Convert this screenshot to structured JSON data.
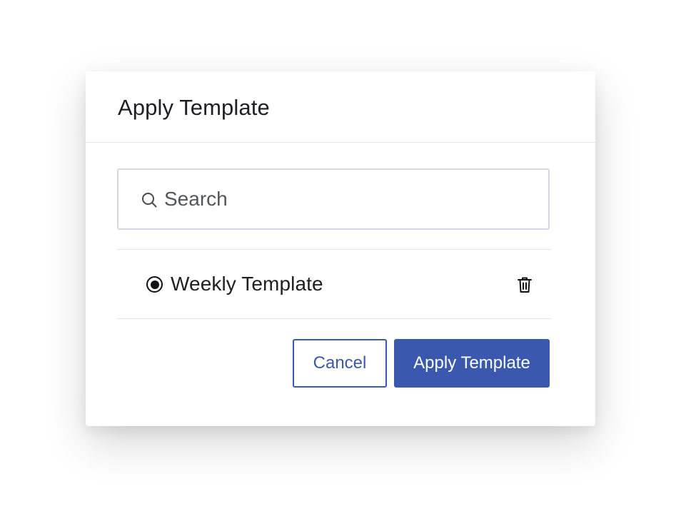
{
  "dialog": {
    "title": "Apply Template"
  },
  "search": {
    "placeholder": "Search",
    "value": "",
    "icon": "search-icon"
  },
  "templates": [
    {
      "label": "Weekly Template",
      "selected": true,
      "delete_icon": "trash-icon"
    }
  ],
  "actions": {
    "cancel_label": "Cancel",
    "apply_label": "Apply Template"
  },
  "colors": {
    "primary": "#3a58ad",
    "text": "#1e1f24",
    "border": "#d4d7e1",
    "divider": "#e3e5ea"
  }
}
